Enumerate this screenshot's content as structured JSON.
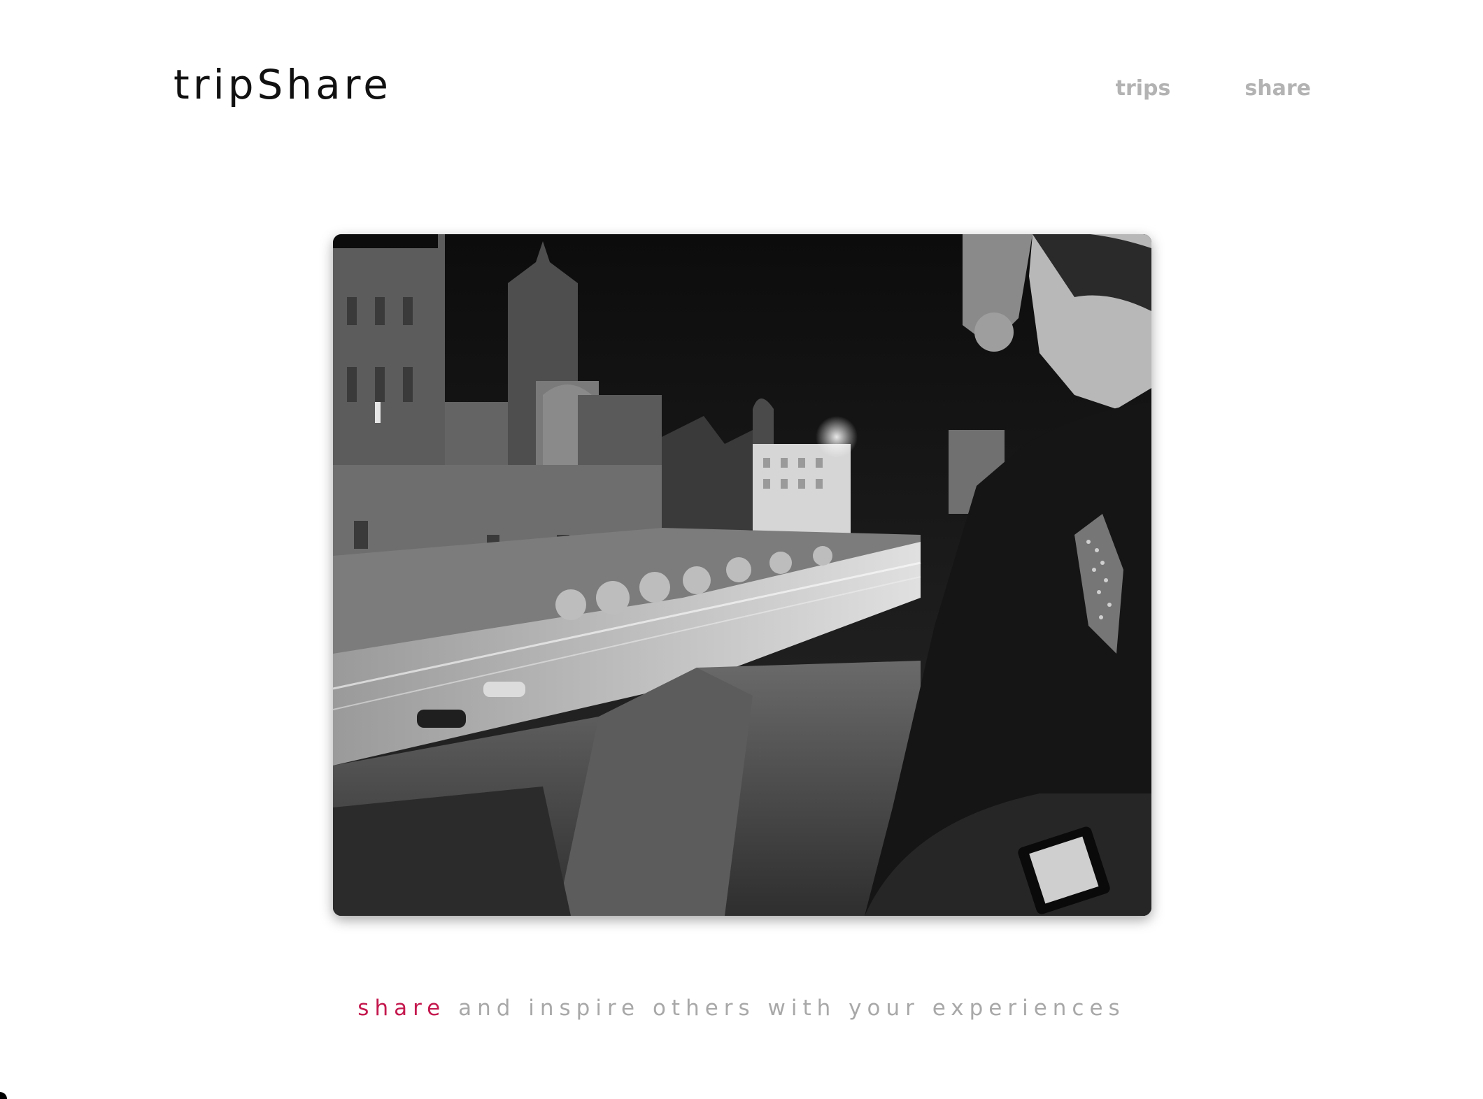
{
  "header": {
    "logo": "tripShare",
    "nav": [
      {
        "label": "trips"
      },
      {
        "label": "share"
      }
    ]
  },
  "hero": {
    "style": "black-and-white night photo"
  },
  "tagline": {
    "accent": "share",
    "rest": " and inspire others with your experiences",
    "accent_color": "#c4184e",
    "text_color": "#a8a8a8"
  }
}
